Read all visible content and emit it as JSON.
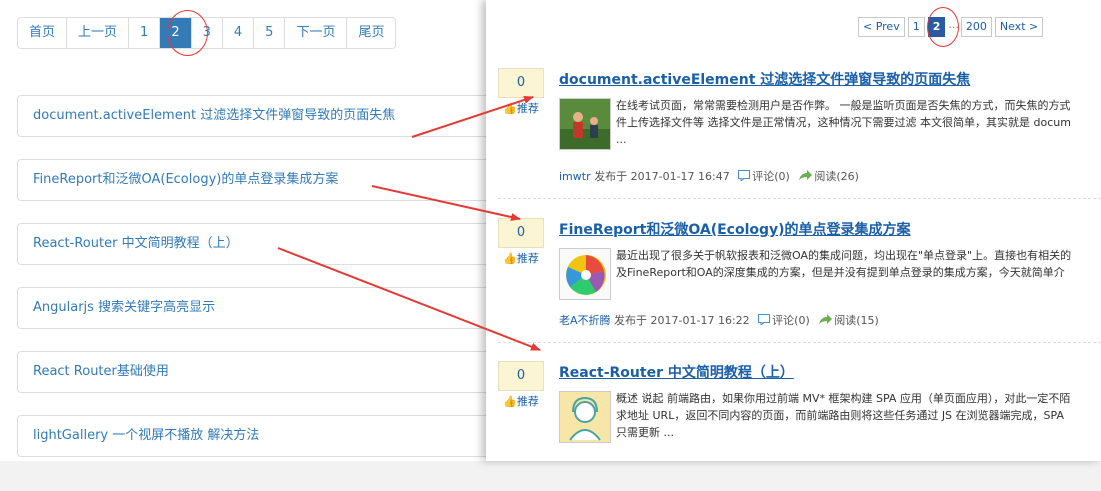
{
  "left_pager": [
    "首页",
    "上一页",
    "1",
    "2",
    "3",
    "4",
    "5",
    "下一页",
    "尾页"
  ],
  "left_pager_active": 3,
  "left_list": [
    "document.activeElement 过滤选择文件弹窗导致的页面失焦",
    "FineReport和泛微OA(Ecology)的单点登录集成方案",
    "React-Router 中文简明教程（上）",
    "Angularjs 搜索关键字高亮显示",
    "React Router基础使用",
    "lightGallery 一个视屏不播放 解决方法"
  ],
  "right_pager": {
    "prev": "< Prev",
    "p1": "1",
    "current": "2",
    "dots": "···",
    "last": "200",
    "next": "Next >"
  },
  "posts": [
    {
      "digg": "0",
      "recommend": "推荐",
      "title": "document.activeElement 过滤选择文件弹窗导致的页面失焦",
      "summary": [
        "在线考试页面，常常需要检测用户是否作弊。 一般是监听页面是否失焦的方式，而失焦的方式",
        "件上传选择文件等 选择文件是正常情况，这种情况下需要过滤 本文很简单，其实就是 docum",
        "..."
      ],
      "author": "imwtr",
      "posted": "发布于 2017-01-17 16:47",
      "comments": "评论(0)",
      "reads": "阅读(26)"
    },
    {
      "digg": "0",
      "recommend": "推荐",
      "title": "FineReport和泛微OA(Ecology)的单点登录集成方案",
      "summary": [
        "最近出现了很多关于帆软报表和泛微OA的集成问题，均出现在\"单点登录\"上。直接也有相关的",
        "及FineReport和OA的深度集成的方案，但是并没有提到单点登录的集成方案，今天就简单介"
      ],
      "author": "老A不折腾",
      "posted": "发布于 2017-01-17 16:22",
      "comments": "评论(0)",
      "reads": "阅读(15)"
    },
    {
      "digg": "0",
      "recommend": "推荐",
      "title": "React-Router 中文简明教程（上）",
      "summary": [
        "概述 说起 前端路由，如果你用过前端 MV* 框架构建 SPA 应用（单页面应用），对此一定不陌",
        "求地址 URL，返回不同内容的页面，而前端路由则将这些任务通过 JS 在浏览器端完成，SPA",
        "只需更新 ..."
      ]
    }
  ],
  "colors": {
    "link": "#337ab7",
    "active_page": "#337ab7",
    "annotation_red": "#e53935",
    "digg_bg": "#fcf5d3"
  }
}
